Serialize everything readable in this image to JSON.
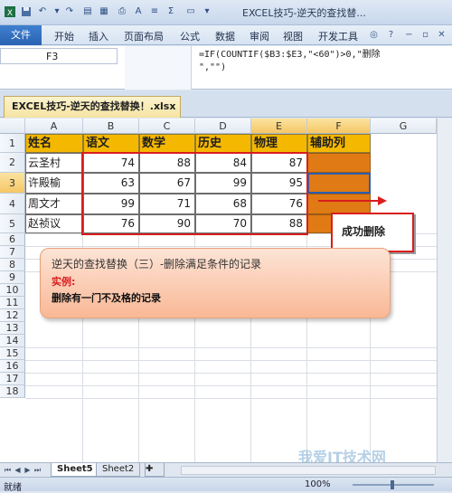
{
  "window": {
    "title": "EXCEL技巧-逆天的查找替..."
  },
  "ribbon": {
    "file_tab": "文件",
    "tabs": [
      "开始",
      "插入",
      "页面布局",
      "公式",
      "数据",
      "审阅",
      "视图",
      "开发工具",
      "帮助"
    ]
  },
  "formula_bar": {
    "name_box": "F3",
    "formula": "=IF(COUNTIF($B3:$E3,\"<60\")>0,\"删除\n\",\"\")"
  },
  "workbook": {
    "tab_label": "EXCEL技巧-逆天的查找替换！.xlsx"
  },
  "grid": {
    "columns": [
      "A",
      "B",
      "C",
      "D",
      "E",
      "F",
      "G"
    ],
    "rows": [
      "1",
      "2",
      "3",
      "4",
      "5",
      "6",
      "7",
      "8",
      "9",
      "10",
      "11",
      "12",
      "13",
      "14",
      "15",
      "16",
      "17",
      "18"
    ],
    "active_column": "F",
    "active_row": "3"
  },
  "table": {
    "headers": [
      "姓名",
      "语文",
      "数学",
      "历史",
      "物理",
      "辅助列"
    ],
    "rows": [
      {
        "name": "云圣村",
        "scores": [
          "74",
          "88",
          "84",
          "87"
        ]
      },
      {
        "name": "许殿榆",
        "scores": [
          "63",
          "67",
          "99",
          "95"
        ]
      },
      {
        "name": "周文才",
        "scores": [
          "99",
          "71",
          "68",
          "76"
        ]
      },
      {
        "name": "赵祯议",
        "scores": [
          "76",
          "90",
          "70",
          "88"
        ]
      }
    ]
  },
  "callout": {
    "text": "成功删除"
  },
  "note": {
    "title": "逆天的查找替换（三）-删除满足条件的记录",
    "subtitle": "实例:",
    "line": "删除有一门不及格的记录"
  },
  "sheets": {
    "tabs": [
      "Sheet5",
      "Sheet2"
    ],
    "active": "Sheet5"
  },
  "status": {
    "ready": "就绪",
    "zoom": "100%"
  },
  "watermark": {
    "text": "我爱IT技术网"
  },
  "colors": {
    "header_fill": "#f5b800",
    "helper_fill": "#e07a14",
    "highlight_red": "#d81e1e",
    "note_fill": "#f9b896"
  }
}
